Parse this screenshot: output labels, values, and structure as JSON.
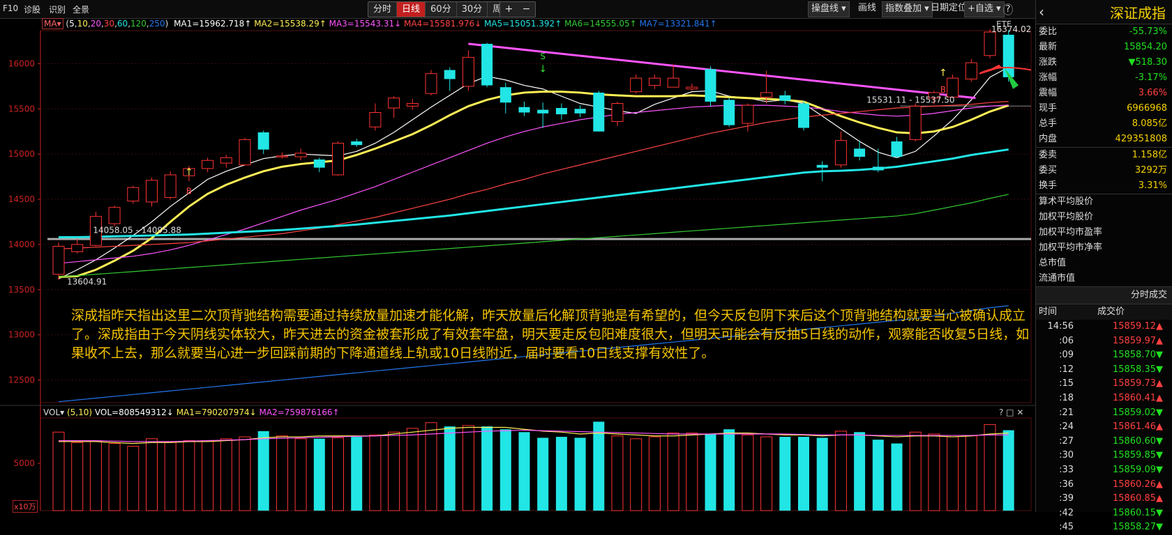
{
  "toolbar": {
    "f10": "F10",
    "diagnose": "诊股",
    "identify": "识别",
    "panorama": "全景",
    "periods": [
      "分时",
      "日线",
      "60分",
      "30分",
      "周线 ▾"
    ],
    "active_period": "日线",
    "zoom_in": "+",
    "zoom_out": "−",
    "draw_line": "操盘线 ▾",
    "paint": "画线",
    "index_overlay": "指数叠加 ▾",
    "date_locate": "日期定位",
    "add_watch": "+自选 ▾",
    "help": "?"
  },
  "indicator_bar": {
    "ma_label": "MA▾",
    "params_open": "(",
    "p5": "5",
    "p10": "10",
    "p20": "20",
    "p30": "30",
    "p60": "60",
    "p120": "120",
    "p250": "250",
    "params_close": ")",
    "ma1": "MA1=15962.718↑",
    "ma2": "MA2=15538.29↑",
    "ma3": "MA3=15543.31↓",
    "ma4": "MA4=15581.976↓",
    "ma5": "MA5=15051.392↑",
    "ma6": "MA6=14555.05↑",
    "ma7": "MA7=13321.841↑",
    "etf": "ETF"
  },
  "chart_data": {
    "type": "candlestick",
    "ylim": [
      12250,
      16350
    ],
    "y_ticks": [
      12500,
      13000,
      13500,
      14000,
      14500,
      15000,
      15500,
      16000
    ],
    "candles": [
      {
        "o": 13670,
        "c": 13980,
        "h": 14020,
        "l": 13610
      },
      {
        "o": 13920,
        "c": 14000,
        "h": 14060,
        "l": 13900
      },
      {
        "o": 13990,
        "c": 14310,
        "h": 14360,
        "l": 13980
      },
      {
        "o": 14230,
        "c": 14410,
        "h": 14430,
        "l": 14200
      },
      {
        "o": 14480,
        "c": 14630,
        "h": 14650,
        "l": 14450
      },
      {
        "o": 14470,
        "c": 14710,
        "h": 14740,
        "l": 14420
      },
      {
        "o": 14520,
        "c": 14770,
        "h": 14810,
        "l": 14500
      },
      {
        "o": 14760,
        "c": 14840,
        "h": 14870,
        "l": 14700
      },
      {
        "o": 14840,
        "c": 14930,
        "h": 14960,
        "l": 14800
      },
      {
        "o": 14900,
        "c": 14960,
        "h": 14990,
        "l": 14850
      },
      {
        "o": 14880,
        "c": 15160,
        "h": 15180,
        "l": 14870
      },
      {
        "o": 15240,
        "c": 15050,
        "h": 15260,
        "l": 15000
      },
      {
        "o": 14980,
        "c": 14980,
        "h": 15020,
        "l": 14950
      },
      {
        "o": 14970,
        "c": 15010,
        "h": 15060,
        "l": 14930
      },
      {
        "o": 14940,
        "c": 14850,
        "h": 14960,
        "l": 14800
      },
      {
        "o": 14770,
        "c": 15120,
        "h": 15140,
        "l": 14760
      },
      {
        "o": 15140,
        "c": 15100,
        "h": 15170,
        "l": 15080
      },
      {
        "o": 15300,
        "c": 15460,
        "h": 15560,
        "l": 15260
      },
      {
        "o": 15510,
        "c": 15620,
        "h": 15640,
        "l": 15400
      },
      {
        "o": 15530,
        "c": 15560,
        "h": 15610,
        "l": 15490
      },
      {
        "o": 15670,
        "c": 15890,
        "h": 15930,
        "l": 15650
      },
      {
        "o": 15930,
        "c": 15830,
        "h": 15960,
        "l": 15700
      },
      {
        "o": 15750,
        "c": 16070,
        "h": 16150,
        "l": 15700
      },
      {
        "o": 16220,
        "c": 15760,
        "h": 16230,
        "l": 15740
      },
      {
        "o": 15740,
        "c": 15570,
        "h": 15790,
        "l": 15450
      },
      {
        "o": 15520,
        "c": 15460,
        "h": 15580,
        "l": 15420
      },
      {
        "o": 15490,
        "c": 15450,
        "h": 15570,
        "l": 15290
      },
      {
        "o": 15510,
        "c": 15440,
        "h": 15560,
        "l": 15380
      },
      {
        "o": 15500,
        "c": 15450,
        "h": 15540,
        "l": 15410
      },
      {
        "o": 15680,
        "c": 15250,
        "h": 15700,
        "l": 15250
      },
      {
        "o": 15360,
        "c": 15560,
        "h": 15580,
        "l": 15310
      },
      {
        "o": 15690,
        "c": 15840,
        "h": 15880,
        "l": 15670
      },
      {
        "o": 15760,
        "c": 15840,
        "h": 15880,
        "l": 15720
      },
      {
        "o": 15740,
        "c": 15840,
        "h": 15990,
        "l": 15740
      },
      {
        "o": 15720,
        "c": 15740,
        "h": 15780,
        "l": 15700
      },
      {
        "o": 15940,
        "c": 15580,
        "h": 15970,
        "l": 15530
      },
      {
        "o": 15600,
        "c": 15320,
        "h": 15620,
        "l": 15300
      },
      {
        "o": 15340,
        "c": 15540,
        "h": 15560,
        "l": 15250
      },
      {
        "o": 15630,
        "c": 15680,
        "h": 15920,
        "l": 15560
      },
      {
        "o": 15650,
        "c": 15590,
        "h": 15700,
        "l": 15550
      },
      {
        "o": 15560,
        "c": 15290,
        "h": 15590,
        "l": 15260
      },
      {
        "o": 14880,
        "c": 14850,
        "h": 14920,
        "l": 14700
      },
      {
        "o": 14880,
        "c": 15150,
        "h": 15250,
        "l": 14850
      },
      {
        "o": 15060,
        "c": 14970,
        "h": 15150,
        "l": 14930
      },
      {
        "o": 14860,
        "c": 14820,
        "h": 15060,
        "l": 14800
      },
      {
        "o": 15140,
        "c": 14970,
        "h": 15190,
        "l": 14960
      },
      {
        "o": 15160,
        "c": 15530,
        "h": 15560,
        "l": 15140
      },
      {
        "o": 15620,
        "c": 15680,
        "h": 15700,
        "l": 15550
      },
      {
        "o": 15630,
        "c": 15840,
        "h": 15880,
        "l": 15620
      },
      {
        "o": 15830,
        "c": 16010,
        "h": 16050,
        "l": 15800
      },
      {
        "o": 16090,
        "c": 16350,
        "h": 16380,
        "l": 16060
      },
      {
        "o": 16320,
        "c": 15850,
        "h": 16374,
        "l": 15800
      }
    ],
    "ma_series": [
      {
        "name": "MA1",
        "color": "#ffffff",
        "values": [
          13620,
          13720,
          13830,
          13960,
          14100,
          14250,
          14420,
          14570,
          14720,
          14810,
          14880,
          14950,
          14980,
          15000,
          14990,
          14980,
          15030,
          15120,
          15240,
          15380,
          15520,
          15650,
          15780,
          15860,
          15820,
          15760,
          15720,
          15640,
          15560,
          15520,
          15480,
          15450,
          15550,
          15620,
          15690,
          15700,
          15640,
          15620,
          15580,
          15600,
          15560,
          15420,
          15280,
          15140,
          15020,
          14960,
          15030,
          15200,
          15380,
          15600,
          15850,
          15962
        ]
      },
      {
        "name": "MA2",
        "color": "#ffee55",
        "values": [
          13640,
          13650,
          13720,
          13820,
          13930,
          14070,
          14250,
          14420,
          14560,
          14660,
          14740,
          14810,
          14860,
          14890,
          14910,
          14930,
          14990,
          15060,
          15140,
          15220,
          15320,
          15430,
          15530,
          15600,
          15650,
          15680,
          15690,
          15690,
          15680,
          15660,
          15650,
          15640,
          15640,
          15640,
          15650,
          15640,
          15630,
          15620,
          15610,
          15600,
          15580,
          15500,
          15420,
          15350,
          15290,
          15240,
          15230,
          15250,
          15300,
          15380,
          15470,
          15538
        ]
      },
      {
        "name": "MA3",
        "color": "#ff55ff",
        "values": [
          13790,
          13810,
          13830,
          13850,
          13870,
          13900,
          13940,
          13990,
          14050,
          14110,
          14170,
          14240,
          14310,
          14380,
          14440,
          14500,
          14570,
          14640,
          14720,
          14800,
          14880,
          14960,
          15040,
          15120,
          15190,
          15250,
          15300,
          15340,
          15380,
          15410,
          15440,
          15460,
          15480,
          15500,
          15520,
          15530,
          15540,
          15540,
          15540,
          15530,
          15520,
          15500,
          15470,
          15450,
          15430,
          15420,
          15430,
          15450,
          15480,
          15510,
          15530,
          15543
        ]
      },
      {
        "name": "MA4",
        "color": "#ff4444",
        "values": [
          13950,
          13960,
          13970,
          13980,
          13990,
          14000,
          14010,
          14020,
          14040,
          14060,
          14080,
          14100,
          14120,
          14150,
          14180,
          14220,
          14260,
          14300,
          14350,
          14400,
          14450,
          14500,
          14560,
          14610,
          14670,
          14720,
          14780,
          14830,
          14880,
          14930,
          14980,
          15030,
          15080,
          15130,
          15180,
          15230,
          15270,
          15310,
          15350,
          15380,
          15410,
          15430,
          15450,
          15470,
          15490,
          15510,
          15520,
          15530,
          15540,
          15550,
          15570,
          15582
        ]
      },
      {
        "name": "MA5",
        "color": "#22e5e5",
        "values": [
          14080,
          14080,
          14085,
          14090,
          14095,
          14100,
          14105,
          14110,
          14120,
          14130,
          14140,
          14150,
          14160,
          14175,
          14190,
          14205,
          14220,
          14240,
          14260,
          14280,
          14300,
          14320,
          14345,
          14370,
          14395,
          14420,
          14445,
          14470,
          14495,
          14520,
          14545,
          14570,
          14595,
          14620,
          14645,
          14670,
          14695,
          14720,
          14745,
          14770,
          14795,
          14810,
          14815,
          14825,
          14840,
          14860,
          14890,
          14920,
          14950,
          14990,
          15020,
          15051
        ]
      },
      {
        "name": "MA6",
        "color": "#33cc33",
        "values": [
          13640,
          13655,
          13670,
          13685,
          13700,
          13715,
          13730,
          13745,
          13760,
          13775,
          13790,
          13805,
          13820,
          13835,
          13850,
          13865,
          13880,
          13895,
          13910,
          13925,
          13940,
          13955,
          13970,
          13985,
          14000,
          14015,
          14030,
          14045,
          14060,
          14075,
          14090,
          14105,
          14120,
          14135,
          14150,
          14165,
          14180,
          14195,
          14210,
          14225,
          14240,
          14255,
          14270,
          14285,
          14300,
          14315,
          14340,
          14380,
          14420,
          14460,
          14510,
          14555
        ]
      },
      {
        "name": "MA7",
        "color": "#2277ee",
        "values": [
          12260,
          12280,
          12300,
          12320,
          12340,
          12360,
          12380,
          12400,
          12420,
          12440,
          12460,
          12480,
          12500,
          12520,
          12540,
          12560,
          12580,
          12600,
          12620,
          12640,
          12660,
          12680,
          12700,
          12720,
          12740,
          12760,
          12780,
          12800,
          12820,
          12840,
          12860,
          12880,
          12900,
          12920,
          12940,
          12960,
          12980,
          13000,
          13020,
          13040,
          13060,
          13080,
          13100,
          13120,
          13140,
          13160,
          13180,
          13210,
          13240,
          13270,
          13300,
          13322
        ]
      }
    ],
    "volume": {
      "ylim": [
        0,
        9500
      ],
      "y_ticks": [
        5000
      ],
      "values": [
        8300,
        7200,
        7300,
        7100,
        6800,
        7600,
        7200,
        7400,
        7400,
        7600,
        7800,
        8400,
        7900,
        7600,
        7600,
        7700,
        7800,
        8000,
        8300,
        8700,
        9300,
        8900,
        9000,
        8900,
        8600,
        8300,
        7700,
        7800,
        7700,
        9400,
        7900,
        7600,
        7800,
        8200,
        8200,
        8100,
        8600,
        8000,
        7800,
        7800,
        7800,
        7700,
        8400,
        8300,
        7500,
        7100,
        8300,
        8100,
        7800,
        7900,
        9100,
        8500
      ],
      "ma1": [
        7300,
        7300,
        7300,
        7200,
        7100,
        7200,
        7200,
        7300,
        7300,
        7400,
        7500,
        7700,
        7800,
        7800,
        7900,
        7900,
        7900,
        7900,
        8100,
        8300,
        8500,
        8700,
        8800,
        8800,
        8800,
        8600,
        8400,
        8300,
        8100,
        8200,
        8100,
        8000,
        7900,
        7900,
        8000,
        8100,
        8200,
        8200,
        8100,
        8000,
        8000,
        7900,
        8000,
        8000,
        7900,
        7800,
        7900,
        7900,
        7800,
        7900,
        8100,
        8200
      ],
      "ma2": [
        7400,
        7400,
        7400,
        7350,
        7300,
        7300,
        7300,
        7350,
        7400,
        7450,
        7500,
        7600,
        7650,
        7700,
        7750,
        7800,
        7850,
        7900,
        7950,
        8000,
        8100,
        8200,
        8300,
        8400,
        8450,
        8500,
        8450,
        8400,
        8350,
        8300,
        8250,
        8200,
        8150,
        8100,
        8100,
        8100,
        8100,
        8100,
        8100,
        8100,
        8050,
        8000,
        8000,
        8000,
        7950,
        7950,
        7950,
        7950,
        7950,
        7950,
        8000,
        8000
      ]
    },
    "labels": {
      "high_mark": "16374.02",
      "low_mark": "13604.91",
      "range_left": "14058.05 - 14095.88",
      "range_right": "15531.11 - 15537.50",
      "b1": "B",
      "b2": "B",
      "s1": "S"
    }
  },
  "annotation": "深成指昨天指出这里二次顶背驰结构需要通过持续放量加速才能化解，昨天放量后化解顶背驰是有希望的，但今天反包阴下来后这个顶背驰结构就要当心被确认成立了。深成指由于今天阴线实体较大，昨天进去的资金被套形成了有效套牢盘，明天要走反包阳难度很大，但明天可能会有反抽5日线的动作，观察能否收复5日线，如果收不上去，那么就要当心进一步回踩前期的下降通道线上轨或10日线附近，届时要看10日线支撑有效性了。",
  "volume_bar": {
    "label": "VOL▾",
    "params": "(5,10)",
    "vol": "VOL=808549312↓",
    "ma1": "MA1=790207974↓",
    "ma2": "MA2=759876166↑",
    "zoom": "x10万",
    "help": "? □ ✕"
  },
  "sidebar": {
    "back": "‹",
    "name": "深证成指",
    "quote": [
      {
        "k": "委比",
        "v": "-55.73%",
        "c": "#20e020"
      },
      {
        "k": "最新",
        "v": "15854.20",
        "c": "#20e020"
      },
      {
        "k": "涨跌",
        "v": "▼518.30",
        "c": "#20e020"
      },
      {
        "k": "涨幅",
        "v": "-3.17%",
        "c": "#20e020"
      },
      {
        "k": "震幅",
        "v": "3.66%",
        "c": "#ff4040"
      },
      {
        "k": "现手",
        "v": "6966968",
        "c": "#f5d100"
      },
      {
        "k": "总手",
        "v": "8.085亿",
        "c": "#f5d100"
      },
      {
        "k": "内盘",
        "v": "429351808",
        "c": "#f5d100"
      }
    ],
    "quote2": [
      {
        "k": "委卖",
        "v": "1.158亿",
        "c": "#f5d100"
      },
      {
        "k": "委买",
        "v": "3292万",
        "c": "#f5d100"
      },
      {
        "k": "换手",
        "v": "3.31%",
        "c": "#f5d100"
      }
    ],
    "sections": [
      "算术平均股价",
      "加权平均股价",
      "加权平均市盈率",
      "加权平均市净率",
      "总市值",
      "流通市值"
    ],
    "ticks_title": "分时成交",
    "ticks_header": [
      "时间",
      "成交价"
    ],
    "ticks": [
      {
        "t": "14:56",
        "p": "15859.12▲",
        "c": "#ff4040"
      },
      {
        "t": ":06",
        "p": "15859.97▲",
        "c": "#ff4040"
      },
      {
        "t": ":09",
        "p": "15858.70▼",
        "c": "#20e020"
      },
      {
        "t": ":12",
        "p": "15858.35▼",
        "c": "#20e020"
      },
      {
        "t": ":15",
        "p": "15859.73▲",
        "c": "#ff4040"
      },
      {
        "t": ":18",
        "p": "15860.41▲",
        "c": "#ff4040"
      },
      {
        "t": ":21",
        "p": "15859.02▼",
        "c": "#20e020"
      },
      {
        "t": ":24",
        "p": "15861.46▲",
        "c": "#ff4040"
      },
      {
        "t": ":27",
        "p": "15860.60▼",
        "c": "#20e020"
      },
      {
        "t": ":30",
        "p": "15859.85▼",
        "c": "#20e020"
      },
      {
        "t": ":33",
        "p": "15859.09▼",
        "c": "#20e020"
      },
      {
        "t": ":36",
        "p": "15860.26▲",
        "c": "#ff4040"
      },
      {
        "t": ":39",
        "p": "15860.85▲",
        "c": "#ff4040"
      },
      {
        "t": ":42",
        "p": "15860.15▼",
        "c": "#20e020"
      },
      {
        "t": ":45",
        "p": "15858.27▼",
        "c": "#20e020"
      }
    ]
  },
  "colors": {
    "up": "#ff3333",
    "down": "#22e5e5",
    "axis": "#cc2222",
    "grid": "#3a0c0c",
    "trend": "#ff55ff",
    "support": "#aaaaaa"
  }
}
